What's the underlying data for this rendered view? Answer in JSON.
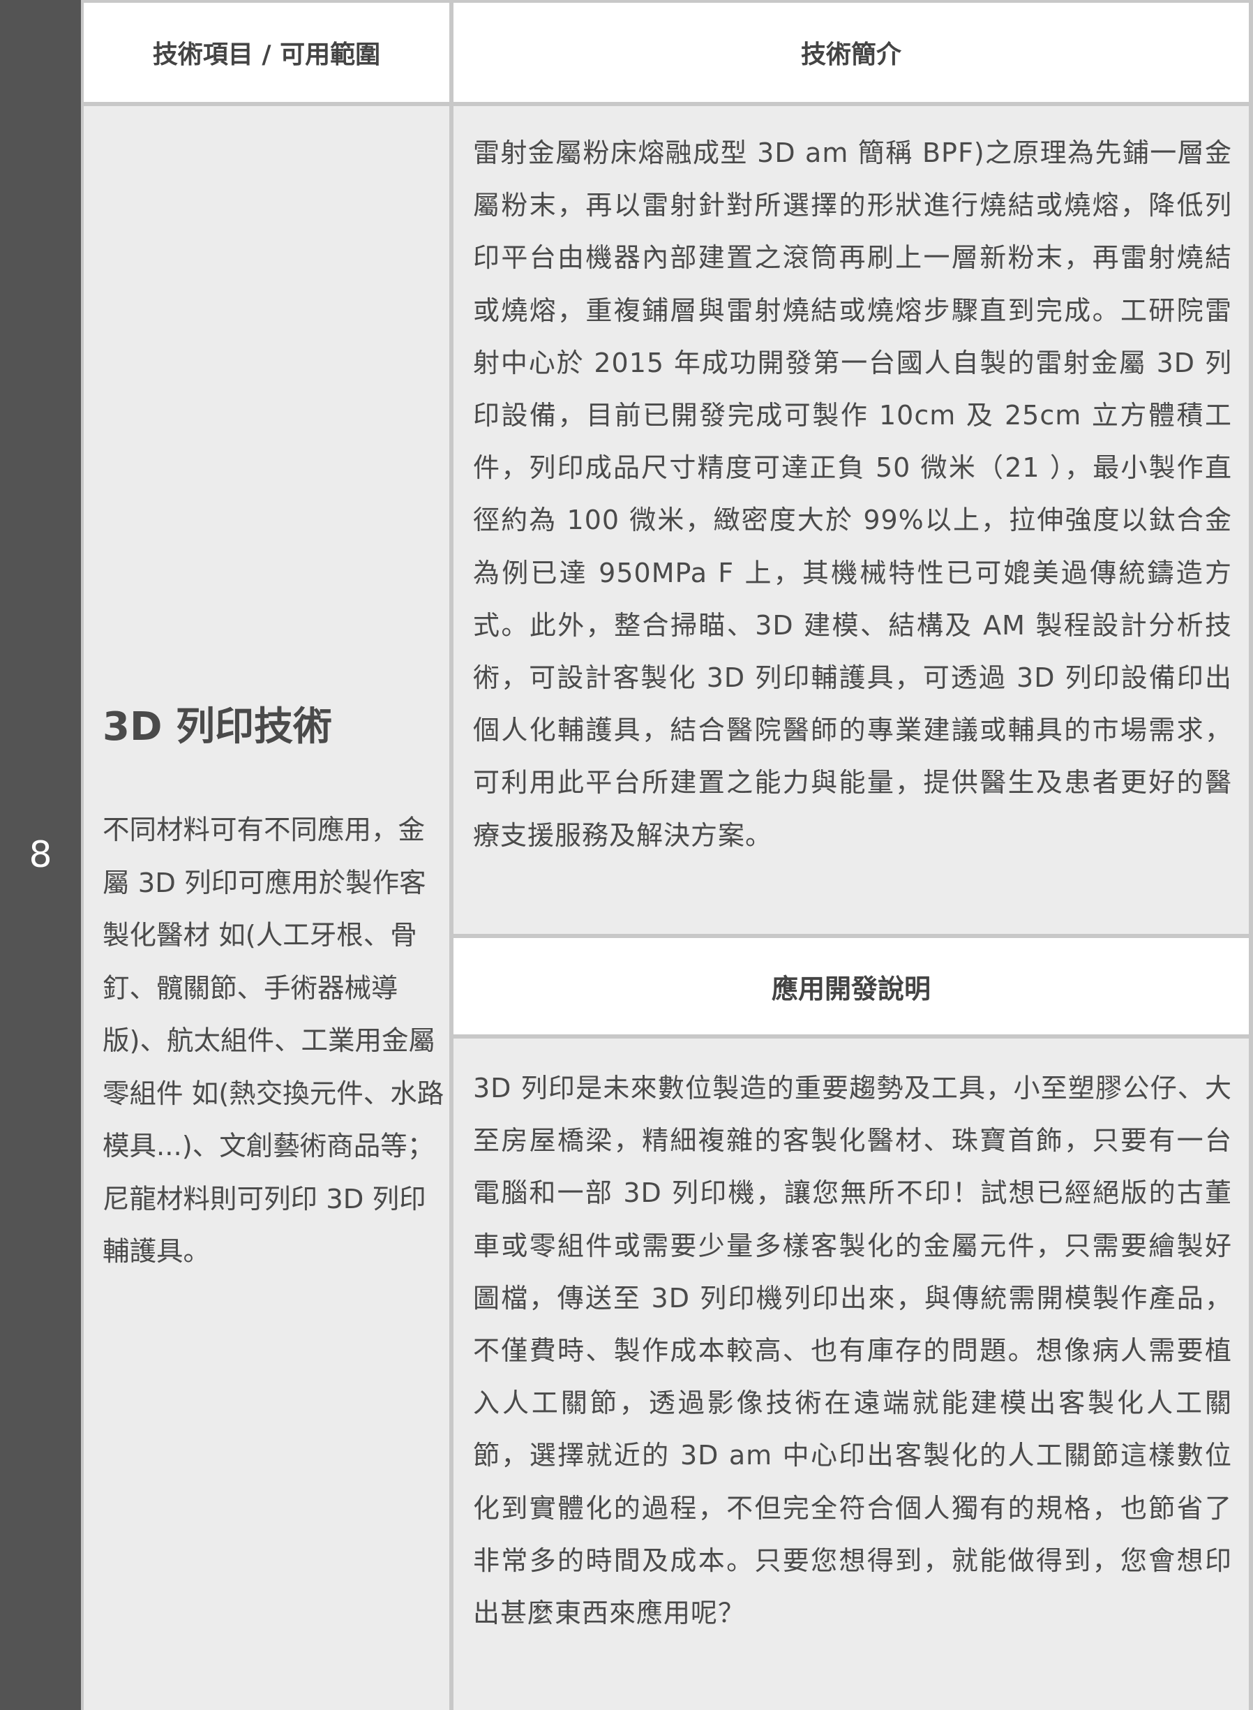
{
  "row": {
    "number": "8"
  },
  "table_header": {
    "left": "技術項目 / 可用範圍",
    "right": "技術簡介"
  },
  "technology": {
    "title": "3D 列印技術",
    "scope": "不同材料可有不同應用，金屬 3D 列印可應用於製作客製化醫材 如(人工牙根、骨釘、髖關節、手術器械導版)、航太組件、工業用金屬零組件 如(熱交換元件、水路模具...)、文創藝術商品等；尼龍材料則可列印 3D 列印輔護具。"
  },
  "introduction": {
    "text": "雷射金屬粉床熔融成型 3D am 簡稱 BPF)之原理為先鋪一層金屬粉末，再以雷射針對所選擇的形狀進行燒結或燒熔，降低列印平台由機器內部建置之滾筒再刷上一層新粉末，再雷射燒結或燒熔，重複鋪層與雷射燒結或燒熔步驟直到完成。工研院雷射中心於 2015 年成功開發第一台國人自製的雷射金屬 3D 列印設備，目前已開發完成可製作 10cm 及 25cm 立方體積工件，列印成品尺寸精度可達正負 50 微米（21 ），最小製作直徑約為 100 微米，緻密度大於 99%以上，拉伸強度以鈦合金為例已達 950MPa F 上，其機械特性已可媲美過傳統鑄造方式。此外，整合掃瞄、3D 建模、結構及 AM 製程設計分析技術，可設計客製化 3D 列印輔護具，可透過 3D 列印設備印出個人化輔護具，結合醫院醫師的專業建議或輔具的市場需求，可利用此平台所建置之能力與能量，提供醫生及患者更好的醫療支援服務及解決方案。"
  },
  "application": {
    "header": "應用開發說明",
    "text": "3D 列印是未來數位製造的重要趨勢及工具，小至塑膠公仔、大至房屋橋梁，精細複雜的客製化醫材、珠寶首飾，只要有一台電腦和一部 3D 列印機，讓您無所不印！試想已經絕版的古董車或零組件或需要少量多樣客製化的金屬元件，只需要繪製好圖檔，傳送至 3D 列印機列印出來，與傳統需開模製作產品，不僅費時、製作成本較高、也有庫存的問題。想像病人需要植入人工關節，透過影像技術在遠端就能建模出客製化人工關節，選擇就近的 3D am 中心印出客製化的人工關節這樣數位化到實體化的過程，不但完全符合個人獨有的規格，也節省了非常多的時間及成本。只要您想得到，就能做得到，您會想印出甚麼東西來應用呢？"
  }
}
